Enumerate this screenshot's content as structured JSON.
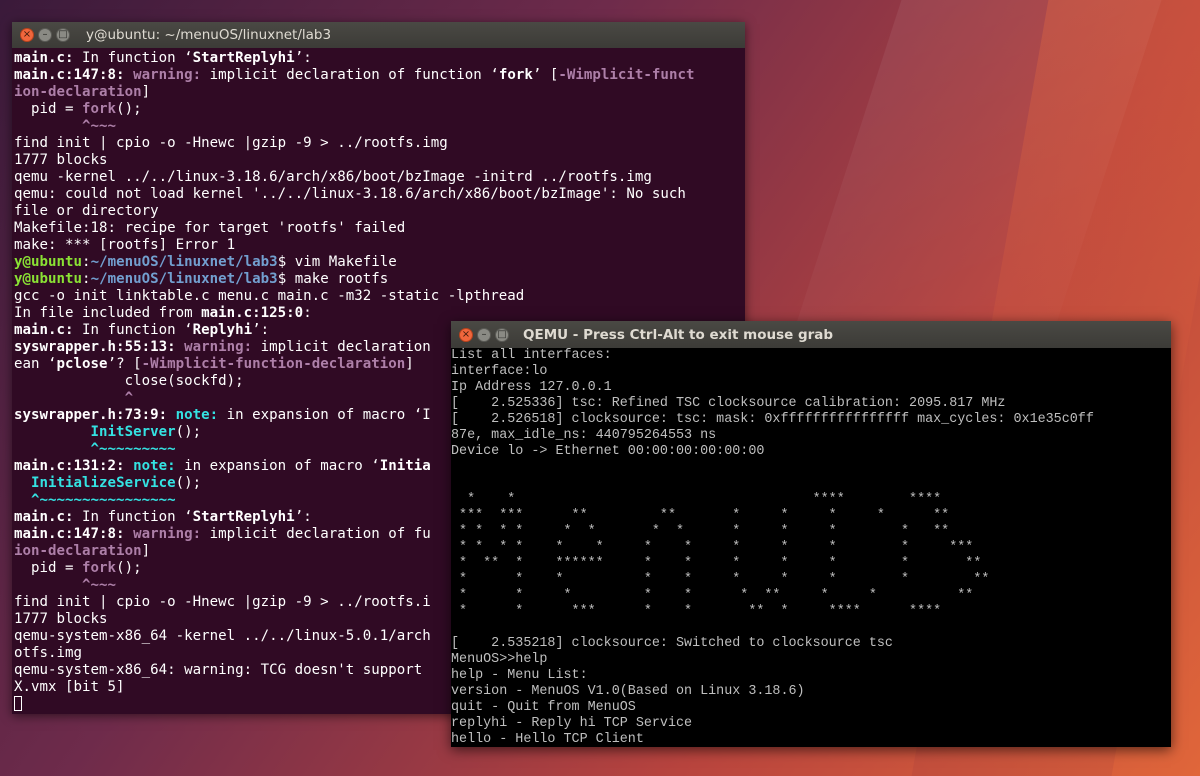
{
  "terminal": {
    "title": "y@ubuntu: ~/menuOS/linuxnet/lab3",
    "lines": [
      [
        {
          "t": "main.c:",
          "c": "b"
        },
        {
          "t": " In function ‘"
        },
        {
          "t": "StartReplyhi",
          "c": "b"
        },
        {
          "t": "’:"
        }
      ],
      [
        {
          "t": "main.c:147:8:",
          "c": "b"
        },
        {
          "t": " "
        },
        {
          "t": "warning:",
          "c": "w"
        },
        {
          "t": " implicit declaration of function ‘"
        },
        {
          "t": "fork",
          "c": "b"
        },
        {
          "t": "’ ["
        },
        {
          "t": "-Wimplicit-funct",
          "c": "w"
        }
      ],
      [
        {
          "t": "ion-declaration",
          "c": "w"
        },
        {
          "t": "]"
        }
      ],
      [
        {
          "t": "  pid = "
        },
        {
          "t": "fork",
          "c": "w"
        },
        {
          "t": "();"
        }
      ],
      [
        {
          "t": "        ^~~~",
          "c": "w"
        }
      ],
      [
        {
          "t": "find init | cpio -o -Hnewc |gzip -9 > ../rootfs.img"
        }
      ],
      [
        {
          "t": "1777 blocks"
        }
      ],
      [
        {
          "t": "qemu -kernel ../../linux-3.18.6/arch/x86/boot/bzImage -initrd ../rootfs.img"
        }
      ],
      [
        {
          "t": "qemu: could not load kernel '../../linux-3.18.6/arch/x86/boot/bzImage': No such"
        }
      ],
      [
        {
          "t": "file or directory"
        }
      ],
      [
        {
          "t": "Makefile:18: recipe for target 'rootfs' failed"
        }
      ],
      [
        {
          "t": "make: *** [rootfs] Error 1"
        }
      ],
      [
        {
          "t": "y@ubuntu",
          "c": "g"
        },
        {
          "t": ":"
        },
        {
          "t": "~/menuOS/linuxnet/lab3",
          "c": "bl"
        },
        {
          "t": "$ vim Makefile"
        }
      ],
      [
        {
          "t": "y@ubuntu",
          "c": "g"
        },
        {
          "t": ":"
        },
        {
          "t": "~/menuOS/linuxnet/lab3",
          "c": "bl"
        },
        {
          "t": "$ make rootfs"
        }
      ],
      [
        {
          "t": "gcc -o init linktable.c menu.c main.c -m32 -static -lpthread"
        }
      ],
      [
        {
          "t": "In file included from "
        },
        {
          "t": "main.c:125:0",
          "c": "b"
        },
        {
          "t": ":"
        }
      ],
      [
        {
          "t": "main.c:",
          "c": "b"
        },
        {
          "t": " In function ‘"
        },
        {
          "t": "Replyhi",
          "c": "b"
        },
        {
          "t": "’:"
        }
      ],
      [
        {
          "t": "syswrapper.h:55:13:",
          "c": "b"
        },
        {
          "t": " "
        },
        {
          "t": "warning:",
          "c": "w"
        },
        {
          "t": " implicit declaration"
        }
      ],
      [
        {
          "t": "ean ‘"
        },
        {
          "t": "pclose",
          "c": "b"
        },
        {
          "t": "’? ["
        },
        {
          "t": "-Wimplicit-function-declaration",
          "c": "w"
        },
        {
          "t": "]"
        }
      ],
      [
        {
          "t": "             close(sockfd);"
        }
      ],
      [
        {
          "t": "             ^",
          "c": "w"
        }
      ],
      [
        {
          "t": "syswrapper.h:73:9:",
          "c": "b"
        },
        {
          "t": " "
        },
        {
          "t": "note:",
          "c": "n"
        },
        {
          "t": " in expansion of macro ‘I"
        }
      ],
      [
        {
          "t": "         "
        },
        {
          "t": "InitServer",
          "c": "n"
        },
        {
          "t": "();"
        }
      ],
      [
        {
          "t": "         ^~~~~~~~~~",
          "c": "n"
        }
      ],
      [
        {
          "t": "main.c:131:2:",
          "c": "b"
        },
        {
          "t": " "
        },
        {
          "t": "note:",
          "c": "n"
        },
        {
          "t": " in expansion of macro ‘"
        },
        {
          "t": "Initia",
          "c": "b"
        }
      ],
      [
        {
          "t": "  "
        },
        {
          "t": "InitializeService",
          "c": "n"
        },
        {
          "t": "();"
        }
      ],
      [
        {
          "t": "  ^~~~~~~~~~~~~~~~~",
          "c": "n"
        }
      ],
      [
        {
          "t": "main.c:",
          "c": "b"
        },
        {
          "t": " In function ‘"
        },
        {
          "t": "StartReplyhi",
          "c": "b"
        },
        {
          "t": "’:"
        }
      ],
      [
        {
          "t": "main.c:147:8:",
          "c": "b"
        },
        {
          "t": " "
        },
        {
          "t": "warning:",
          "c": "w"
        },
        {
          "t": " implicit declaration of fu"
        }
      ],
      [
        {
          "t": "ion-declaration",
          "c": "w"
        },
        {
          "t": "]"
        }
      ],
      [
        {
          "t": "  pid = "
        },
        {
          "t": "fork",
          "c": "w"
        },
        {
          "t": "();"
        }
      ],
      [
        {
          "t": "        ^~~~",
          "c": "w"
        }
      ],
      [
        {
          "t": "find init | cpio -o -Hnewc |gzip -9 > ../rootfs.i"
        }
      ],
      [
        {
          "t": "1777 blocks"
        }
      ],
      [
        {
          "t": "qemu-system-x86_64 -kernel ../../linux-5.0.1/arch"
        }
      ],
      [
        {
          "t": "otfs.img"
        }
      ],
      [
        {
          "t": "qemu-system-x86_64: warning: TCG doesn't support"
        }
      ],
      [
        {
          "t": "X.vmx [bit 5]"
        }
      ]
    ]
  },
  "qemu": {
    "title": "QEMU - Press Ctrl-Alt to exit mouse grab",
    "lines": [
      "List all interfaces:",
      "interface:lo",
      "Ip Address 127.0.0.1",
      "[    2.525336] tsc: Refined TSC clocksource calibration: 2095.817 MHz",
      "[    2.526518] clocksource: tsc: mask: 0xffffffffffffffff max_cycles: 0x1e35c0ff",
      "87e, max_idle_ns: 440795264553 ns",
      "Device lo -> Ethernet 00:00:00:00:00:00",
      "",
      "",
      "  *    *                                     ****        ****",
      " ***  ***      **         **       *     *     *     *      **",
      " * *  * *     *  *       *  *      *     *     *        *   **",
      " * *  * *    *    *     *    *     *     *     *        *     ***",
      " *  **  *    ******     *    *     *     *     *        *       **",
      " *      *    *          *    *     *     *     *        *        **",
      " *      *     *         *    *      *  **     *     *          **",
      " *      *      ***      *    *       **  *     ****      ****",
      "",
      "[    2.535218] clocksource: Switched to clocksource tsc",
      "MenuOS>>help",
      "help - Menu List:",
      "version - MenuOS V1.0(Based on Linux 3.18.6)",
      "quit - Quit from MenuOS",
      "replyhi - Reply hi TCP Service",
      "hello - Hello TCP Client",
      "MenuOS>>_"
    ]
  },
  "icons": {
    "close": "×",
    "minimize": "–",
    "maximize": "□"
  },
  "colors": {
    "terminal_bg": "#300a24",
    "warning": "#ad7fa8",
    "note": "#34e2e2",
    "prompt_user": "#8ae234",
    "prompt_path": "#729fcf"
  }
}
